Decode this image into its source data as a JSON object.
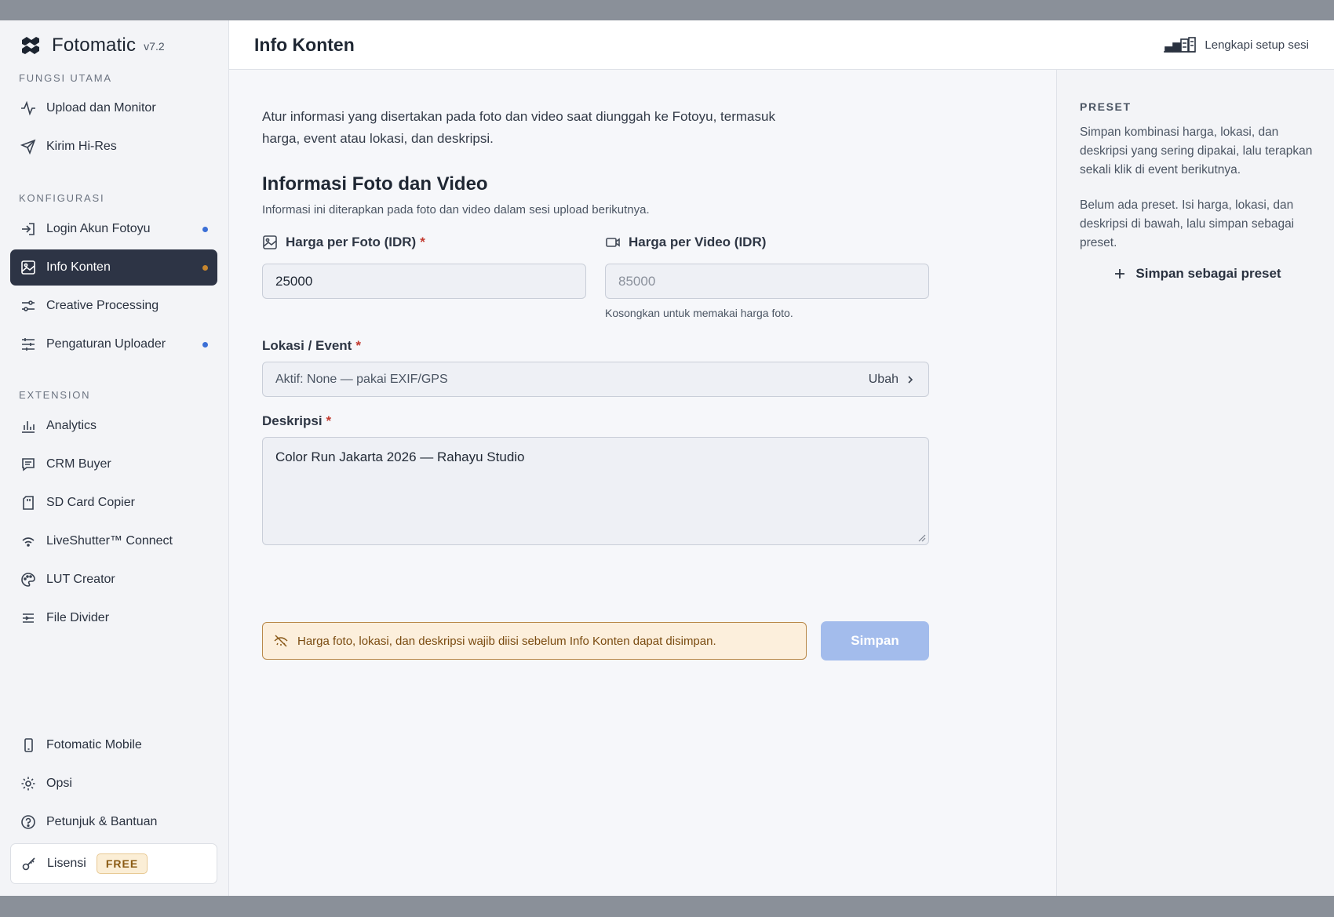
{
  "app": {
    "name": "Fotomatic",
    "version": "v7.2"
  },
  "sidebar": {
    "sections": {
      "main": "FUNGSI UTAMA",
      "config": "KONFIGURASI",
      "extension": "EXTENSION"
    },
    "items": {
      "upload": "Upload dan Monitor",
      "hires": "Kirim Hi-Res",
      "login": "Login Akun Fotoyu",
      "info": "Info Konten",
      "creative": "Creative Processing",
      "uploader": "Pengaturan Uploader",
      "analytics": "Analytics",
      "crm": "CRM Buyer",
      "sdcard": "SD Card Copier",
      "liveshutter": "LiveShutter™ Connect",
      "lut": "LUT Creator",
      "divider": "File Divider",
      "mobile": "Fotomatic Mobile",
      "options": "Opsi",
      "help": "Petunjuk & Bantuan"
    },
    "license": {
      "label": "Lisensi",
      "badge": "FREE"
    }
  },
  "header": {
    "title": "Info Konten",
    "setup_link": "Lengkapi setup sesi"
  },
  "form": {
    "intro": "Atur informasi yang disertakan pada foto dan video saat diunggah ke Fotoyu, termasuk harga, event atau lokasi, dan deskripsi.",
    "section_title": "Informasi Foto dan Video",
    "section_subtitle": "Informasi ini diterapkan pada foto dan video dalam sesi upload berikutnya.",
    "photo_price_label": "Harga per Foto (IDR)",
    "photo_price_value": "25000",
    "video_price_label": "Harga per Video (IDR)",
    "video_price_placeholder": "85000",
    "video_price_hint": "Kosongkan untuk memakai harga foto.",
    "location_label": "Lokasi / Event",
    "location_value": "Aktif: None — pakai EXIF/GPS",
    "location_change": "Ubah",
    "description_label": "Deskripsi",
    "description_value": "Color Run Jakarta 2026 — Rahayu Studio",
    "required_mark": "*",
    "warning": "Harga foto, lokasi, dan deskripsi wajib diisi sebelum Info Konten dapat disimpan.",
    "save_label": "Simpan"
  },
  "preset": {
    "title": "PRESET",
    "description": "Simpan kombinasi harga, lokasi, dan deskripsi yang sering dipakai, lalu terapkan sekali klik di event berikutnya.",
    "empty": "Belum ada preset. Isi harga, lokasi, dan deskripsi di bawah, lalu simpan sebagai preset.",
    "save_preset": "Simpan sebagai preset"
  },
  "colors": {
    "accent": "#2d3445",
    "dot_blue": "#3b6fd6",
    "dot_orange": "#c7862e",
    "save_disabled": "#a3bcec",
    "warning_bg": "#fcefdc"
  }
}
